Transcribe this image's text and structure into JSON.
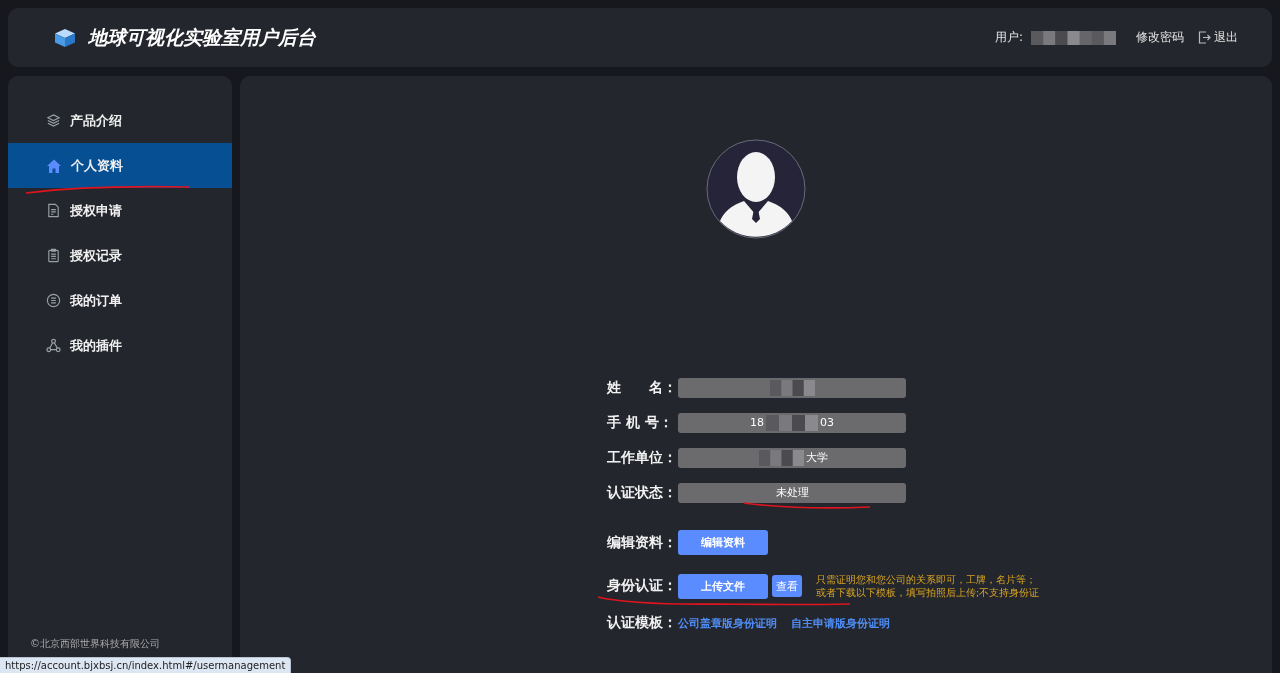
{
  "header": {
    "title": "地球可视化实验室用户后台",
    "user_label": "用户:",
    "user_masked": true,
    "links": [
      {
        "label": "修改密码",
        "kind": "text"
      },
      {
        "label": "退出",
        "kind": "logout"
      }
    ]
  },
  "sidebar": {
    "items": [
      {
        "label": "产品介绍",
        "kind": "layers",
        "selected": false
      },
      {
        "label": "个人资料",
        "kind": "home",
        "selected": true
      },
      {
        "label": "授权申请",
        "kind": "document",
        "selected": false
      },
      {
        "label": "授权记录",
        "kind": "clipboard",
        "selected": false
      },
      {
        "label": "我的订单",
        "kind": "list",
        "selected": false
      },
      {
        "label": "我的插件",
        "kind": "nodes",
        "selected": false
      }
    ],
    "footer": "©北京西部世界科技有限公司"
  },
  "profile": {
    "fields": [
      {
        "label": "姓　　名：",
        "masked": true
      },
      {
        "label": "手 机 号：",
        "value_prefix": "18",
        "value_suffix": "03",
        "masked": true
      },
      {
        "label": "工作单位：",
        "value_suffix": "大学",
        "masked": true
      },
      {
        "label": "认证状态：",
        "value": "未处理",
        "masked": false
      }
    ],
    "edit": {
      "label": "编辑资料：",
      "button": "编辑资料"
    },
    "identity": {
      "label": "身份认证：",
      "button": "上传文件",
      "view_button": "查看",
      "note": [
        "只需证明您和您公司的关系即可，工牌，名片等；",
        "或者下载以下模板，填写拍照后上传;不支持身份证"
      ]
    },
    "templates": {
      "label": "认证模板：",
      "links": [
        "公司盖章版身份证明",
        "自主申请版身份证明"
      ]
    }
  },
  "status_url": "https://account.bjxbsj.cn/index.html#/usermanagement"
}
